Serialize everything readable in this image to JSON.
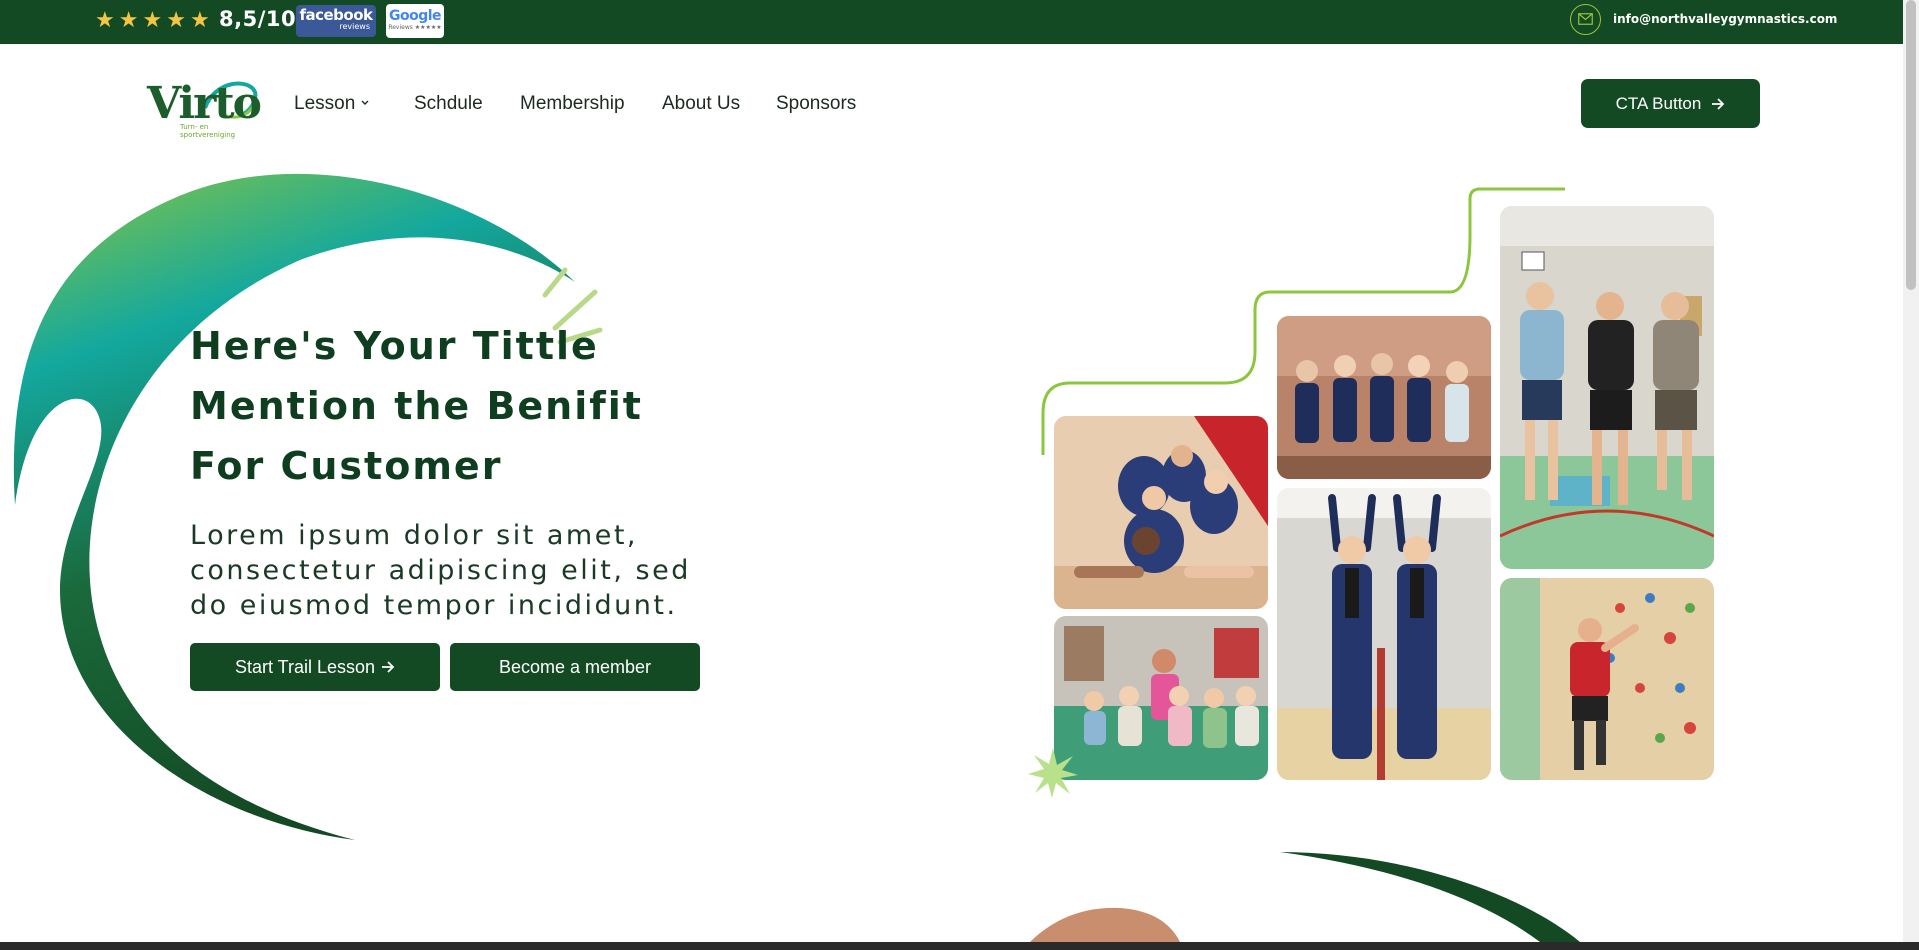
{
  "topbar": {
    "rating": "8,5/10",
    "stars": 5,
    "facebook_badge": {
      "main": "facebook",
      "sub": "reviews"
    },
    "google_badge": {
      "main": "Google",
      "sub": "Reviews ★★★★★"
    },
    "email": "info@northvalleygymnastics.com",
    "icons": [
      "star-icon",
      "mail-icon"
    ]
  },
  "nav": {
    "logo_word": "Virto",
    "logo_tagline": "Turn- en sportvereniging",
    "items": [
      {
        "label": "Lesson",
        "has_dropdown": true
      },
      {
        "label": "Schdule"
      },
      {
        "label": "Membership"
      },
      {
        "label": "About Us"
      },
      {
        "label": "Sponsors"
      }
    ],
    "cta": "CTA Button"
  },
  "hero": {
    "title_lines": [
      "Here's Your Tittle",
      "Mention the Benifit",
      "For Customer"
    ],
    "subtitle": "Lorem ipsum dolor sit amet, consectetur adipiscing elit, sed do eiusmod tempor incididunt.",
    "primary_button": "Start Trail Lesson",
    "secondary_button": "Become a member"
  },
  "gallery": {
    "photos": [
      "girls-split-photo",
      "kids-group-photo",
      "teen-team-photo",
      "twins-arms-up-photo",
      "seniors-gym-photo",
      "climbing-wall-photo"
    ]
  },
  "colors": {
    "brand_dark": "#134a24",
    "accent_green": "#8cc63f",
    "teal": "#13a89e",
    "star_yellow": "#f4c542"
  }
}
